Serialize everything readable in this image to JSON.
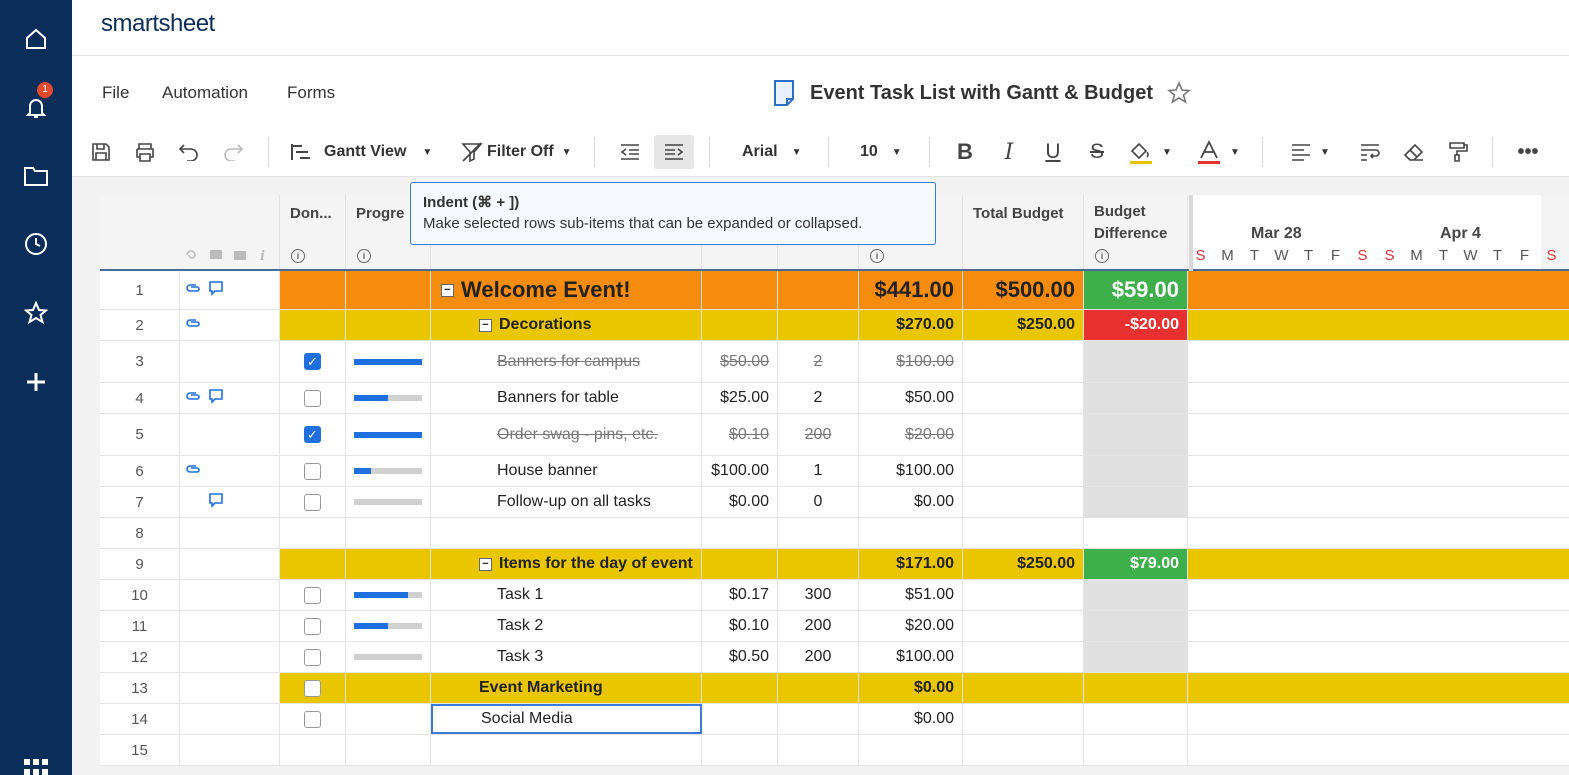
{
  "app": {
    "logo": "smartsheet",
    "notification_count": "1"
  },
  "menu": {
    "file": "File",
    "automation": "Automation",
    "forms": "Forms"
  },
  "sheet": {
    "title": "Event Task List with Gantt & Budget"
  },
  "toolbar": {
    "view": "Gantt View",
    "filter": "Filter Off",
    "font": "Arial",
    "size": "10",
    "accent_fill": "#e8c400",
    "accent_text": "#e0322e"
  },
  "tooltip": {
    "title": "Indent (⌘ + ])",
    "text": "Make selected rows sub-items that can be expanded or collapsed."
  },
  "columns": {
    "done": "Don...",
    "progress": "Progre",
    "total_budget": "Total Budget",
    "budget_difference_1": "Budget",
    "budget_difference_2": "Difference"
  },
  "gantt": {
    "weeks": [
      "Mar 28",
      "Apr 4"
    ],
    "days": [
      "S",
      "M",
      "T",
      "W",
      "T",
      "F",
      "S",
      "S",
      "M",
      "T",
      "W",
      "T",
      "F",
      "S"
    ]
  },
  "rows": [
    {
      "n": "1",
      "task": "Welcome Event!",
      "cost": "",
      "qty": "",
      "total": "$441.00",
      "budget": "$500.00",
      "diff": "$59.00"
    },
    {
      "n": "2",
      "task": "Decorations",
      "cost": "",
      "qty": "",
      "total": "$270.00",
      "budget": "$250.00",
      "diff": "-$20.00"
    },
    {
      "n": "3",
      "task": "Banners for campus",
      "cost": "$50.00",
      "qty": "2",
      "total": "$100.00",
      "done": true,
      "progress": 1.0
    },
    {
      "n": "4",
      "task": "Banners for table",
      "cost": "$25.00",
      "qty": "2",
      "total": "$50.00",
      "done": false,
      "progress": 0.5
    },
    {
      "n": "5",
      "task": "Order swag - pins, etc.",
      "cost": "$0.10",
      "qty": "200",
      "total": "$20.00",
      "done": true,
      "progress": 1.0
    },
    {
      "n": "6",
      "task": "House banner",
      "cost": "$100.00",
      "qty": "1",
      "total": "$100.00",
      "done": false,
      "progress": 0.25
    },
    {
      "n": "7",
      "task": "Follow-up on all tasks",
      "cost": "$0.00",
      "qty": "0",
      "total": "$0.00",
      "done": false,
      "progress": 0.0
    },
    {
      "n": "8"
    },
    {
      "n": "9",
      "task": "Items for the day of event",
      "total": "$171.00",
      "budget": "$250.00",
      "diff": "$79.00"
    },
    {
      "n": "10",
      "task": "Task 1",
      "cost": "$0.17",
      "qty": "300",
      "total": "$51.00",
      "done": false,
      "progress": 0.8
    },
    {
      "n": "11",
      "task": "Task 2",
      "cost": "$0.10",
      "qty": "200",
      "total": "$20.00",
      "done": false,
      "progress": 0.5
    },
    {
      "n": "12",
      "task": "Task 3",
      "cost": "$0.50",
      "qty": "200",
      "total": "$100.00",
      "done": false,
      "progress": 0.0
    },
    {
      "n": "13",
      "task": "Event Marketing",
      "total": "$0.00"
    },
    {
      "n": "14",
      "task": "Social Media",
      "total": "$0.00"
    },
    {
      "n": "15"
    }
  ],
  "colors": {
    "level0": "#f68c0e",
    "level1": "#e9c600",
    "positive": "#3eaf4a",
    "negative": "#e83030",
    "bar_done": "#7ed88b",
    "bar_pending": "#bfe0f5"
  }
}
